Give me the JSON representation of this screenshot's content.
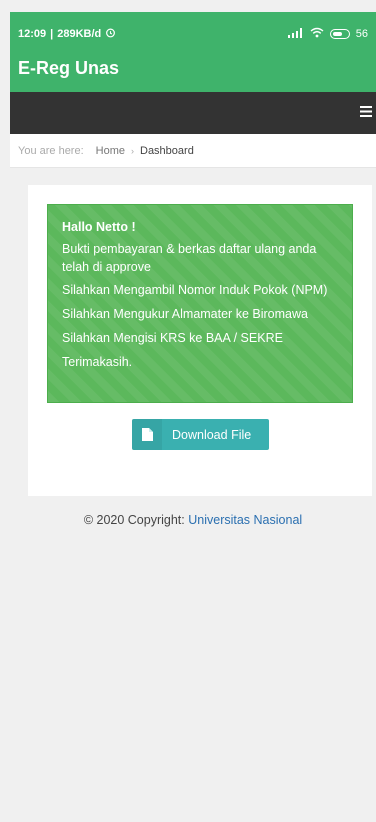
{
  "status_bar": {
    "time": "12:09",
    "network_speed": "289KB/d",
    "alarm_icon": "alarm-icon",
    "battery_level": "56"
  },
  "app": {
    "title": "E-Reg Unas"
  },
  "nav": {
    "menu_icon": "hamburger-icon"
  },
  "breadcrumb": {
    "prefix": "You are here:",
    "home": "Home",
    "separator": "›",
    "current": "Dashboard"
  },
  "alert": {
    "greeting": "Hallo Netto !",
    "lines": [
      "Bukti pembayaran & berkas daftar ulang anda telah di approve",
      "Silahkan Mengambil Nomor Induk Pokok (NPM)",
      "Silahkan Mengukur Almamater ke Biromawa",
      "Silahkan Mengisi KRS ke BAA / SEKRE",
      "Terimakasih."
    ],
    "color": "#5cb85c"
  },
  "download_button": {
    "label": "Download File",
    "icon": "file-icon",
    "color": "#3ab0b0"
  },
  "footer": {
    "copyright": "© 2020 Copyright:",
    "link": "Universitas Nasional"
  },
  "colors": {
    "primary": "#3fb36b",
    "navbar": "#333333",
    "link": "#2a6fb0"
  }
}
